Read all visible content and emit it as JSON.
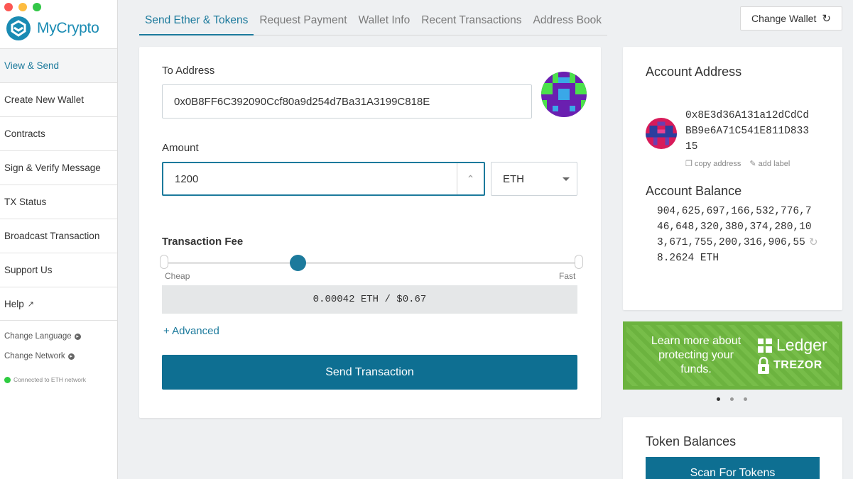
{
  "app": {
    "logo_text": "MyCrypto",
    "window_controls": [
      "#fc5753",
      "#fdbc40",
      "#33c748"
    ]
  },
  "sidebar": {
    "items": [
      {
        "label": "View & Send",
        "active": true
      },
      {
        "label": "Create New Wallet"
      },
      {
        "label": "Contracts"
      },
      {
        "label": "Sign & Verify Message"
      },
      {
        "label": "TX Status"
      },
      {
        "label": "Broadcast Transaction"
      },
      {
        "label": "Support Us"
      },
      {
        "label": "Help"
      }
    ],
    "change_language": "Change Language",
    "change_network": "Change Network",
    "status": "Connected to ETH network"
  },
  "tabs": [
    {
      "label": "Send Ether & Tokens",
      "active": true
    },
    {
      "label": "Request Payment"
    },
    {
      "label": "Wallet Info"
    },
    {
      "label": "Recent Transactions"
    },
    {
      "label": "Address Book"
    }
  ],
  "header": {
    "change_wallet": "Change Wallet"
  },
  "send": {
    "to_label": "To Address",
    "to_value": "0x0B8FF6C392090Ccf80a9d254d7Ba31A3199C818E",
    "amount_label": "Amount",
    "amount_value": "1200",
    "unit": "ETH",
    "fee_title": "Transaction Fee",
    "fee_level": 0.32,
    "cheap": "Cheap",
    "fast": "Fast",
    "fee_value": "0.00042 ETH / $0.67",
    "advanced": "+ Advanced",
    "send_button": "Send Transaction"
  },
  "account": {
    "address_title": "Account Address",
    "address": "0x8E3d36A131a12dCdCdBB9e6A71C541E811D83315",
    "copy_address": "copy address",
    "add_label": "add label",
    "balance_title": "Account Balance",
    "balance": "904,625,697,166,532,776,746,648,320,380,374,280,103,671,755,200,316,906,558.2624 ETH"
  },
  "promo": {
    "text": "Learn more about protecting your funds.",
    "ledger": "Ledger",
    "trezor": "TREZOR"
  },
  "tokens": {
    "title": "Token Balances",
    "scan_button": "Scan For Tokens"
  },
  "colors": {
    "accent": "#1c7a9c",
    "button": "#0e6f92",
    "promo": "#6cb33f",
    "status_ok": "#2ecc40"
  }
}
